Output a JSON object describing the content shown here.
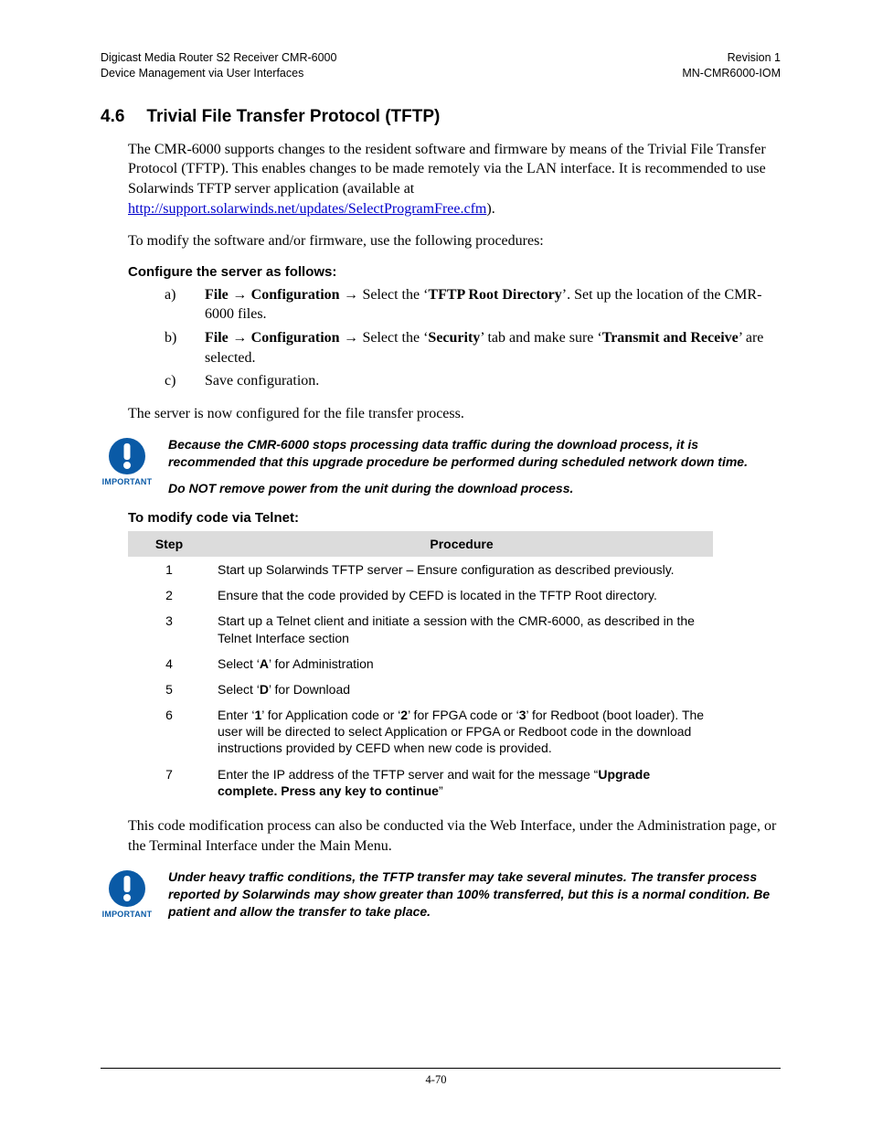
{
  "header": {
    "left_line1": "Digicast Media Router S2 Receiver CMR-6000",
    "left_line2": "Device Management via User Interfaces",
    "right_line1": "Revision 1",
    "right_line2": "MN-CMR6000-IOM"
  },
  "section": {
    "number": "4.6",
    "title": "Trivial File Transfer Protocol (TFTP)"
  },
  "intro": {
    "p1_pre": "The CMR-6000 supports changes to the resident software and firmware by means of the Trivial File Transfer Protocol (TFTP). This enables changes to be made remotely via the LAN interface. It is recommended to use Solarwinds TFTP server application (available at ",
    "p1_link": "http://support.solarwinds.net/updates/SelectProgramFree.cfm",
    "p1_post": ").",
    "p2": "To modify the software and/or firmware, use the following procedures:"
  },
  "configure": {
    "heading": "Configure the server as follows:",
    "items": {
      "a": {
        "marker": "a)",
        "file": "File",
        "arrow1": " → ",
        "conf": "Configuration",
        "arrow2": " → ",
        "mid": " Select the ‘",
        "bold1": "TFTP Root Directory",
        "tail": "’. Set up the location of the CMR-6000 files."
      },
      "b": {
        "marker": "b)",
        "file": "File",
        "arrow1": " → ",
        "conf": "Configuration",
        "arrow2": " → ",
        "mid": " Select the ‘",
        "bold1": "Security",
        "mid2": "’ tab and make sure ‘",
        "bold2": "Transmit and Receive",
        "tail": "’ are selected."
      },
      "c": {
        "marker": "c)",
        "text": "Save configuration."
      }
    }
  },
  "after_config": "The server is now configured for the file transfer process.",
  "important1": {
    "label": "IMPORTANT",
    "p1": "Because the CMR-6000 stops processing data traffic during the download process, it is recommended that this upgrade procedure be performed during scheduled network down time.",
    "p2_pre": "Do ",
    "p2_not": "NOT",
    "p2_post": " remove power from the unit during the download process."
  },
  "telnet_heading": "To modify code via Telnet:",
  "table": {
    "head_step": "Step",
    "head_proc": "Procedure",
    "rows": [
      {
        "step": "1",
        "proc_plain": "Start up Solarwinds TFTP server – Ensure configuration as described previously."
      },
      {
        "step": "2",
        "proc_plain": "Ensure that the code provided by CEFD is located in the TFTP Root directory."
      },
      {
        "step": "3",
        "proc_plain": "Start up a Telnet client and initiate a session with the CMR-6000, as described in the Telnet Interface section"
      },
      {
        "step": "4",
        "pre": "Select ‘",
        "b1": "A",
        "post": "’ for Administration"
      },
      {
        "step": "5",
        "pre": "Select ‘",
        "b1": "D",
        "post": "’ for Download"
      },
      {
        "step": "6",
        "pre": "Enter ‘",
        "b1": "1",
        "m1": "’ for Application code or ‘",
        "b2": "2",
        "m2": "’ for FPGA code or ‘",
        "b3": "3",
        "post": "’ for Redboot (boot loader).  The user will be directed to select Application or FPGA or Redboot code in the download instructions provided by CEFD when new code is provided."
      },
      {
        "step": "7",
        "pre": "Enter the IP address of the TFTP server and wait for the message “",
        "b1": "Upgrade complete. Press any key to continue",
        "post": "”"
      }
    ]
  },
  "after_table": "This code modification process can also be conducted via the Web Interface, under the Administration page, or the Terminal Interface under the Main Menu.",
  "important2": {
    "label": "IMPORTANT",
    "p1": "Under heavy traffic conditions, the TFTP transfer may take several minutes. The transfer process reported by Solarwinds may show greater than 100% transferred, but this is a normal condition.  Be patient and allow the transfer to take place."
  },
  "page_number": "4-70"
}
